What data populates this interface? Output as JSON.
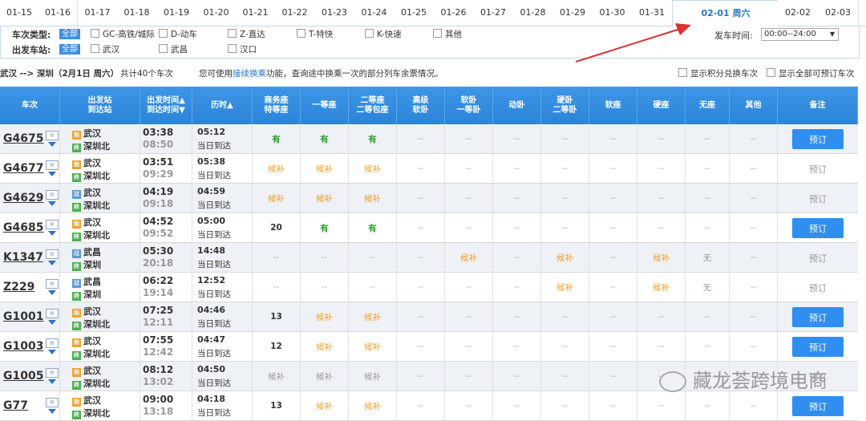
{
  "dates": [
    "01-15",
    "01-16",
    "01-17",
    "01-18",
    "01-19",
    "01-20",
    "01-21",
    "01-22",
    "01-23",
    "01-24",
    "01-25",
    "01-26",
    "01-27",
    "01-28",
    "01-29",
    "01-30",
    "01-31",
    "02-01 周六",
    "02-02",
    "02-03"
  ],
  "filters": {
    "type_label": "车次类型:",
    "type_all": "全部",
    "types": [
      "GC-高铁/城际",
      "D-动车",
      "Z-直达",
      "T-特快",
      "K-快速",
      "其他"
    ],
    "station_label": "出发车站:",
    "station_all": "全部",
    "stations": [
      "武汉",
      "武昌",
      "汉口"
    ],
    "depart_time_label": "发车时间:",
    "depart_time_value": "00:00--24:00"
  },
  "summary": {
    "route": "武汉 --> 深圳（2月1日 周六）",
    "count": "共计40个车次",
    "tip_pre": "您可使用",
    "tip_link": "接续换乘",
    "tip_post": "功能，查询途中换乘一次的部分列车余票情况。",
    "opt1": "显示积分兑换车次",
    "opt2": "显示全部可预订车次"
  },
  "headers": [
    "车次",
    "出发站\n到达站",
    "出发时间▲\n到达时间▼",
    "历时▲",
    "商务座\n特等座",
    "一等座",
    "二等座\n二等包座",
    "高级\n软卧",
    "软卧\n一等卧",
    "动卧",
    "硬卧\n二等卧",
    "软座",
    "硬座",
    "无座",
    "其他",
    "备注"
  ],
  "rows": [
    {
      "train": "G4675",
      "from": "武汉",
      "to": "深圳北",
      "from_type": "始",
      "dep": "03:38",
      "arr": "08:50",
      "dur": "05:12",
      "day": "当日到达",
      "seats": [
        "有",
        "有",
        "有",
        "--",
        "--",
        "--",
        "--",
        "--",
        "--",
        "--",
        "--"
      ],
      "action": "预订",
      "bookable": true
    },
    {
      "train": "G4677",
      "from": "武汉",
      "to": "深圳北",
      "from_type": "始",
      "dep": "03:51",
      "arr": "09:29",
      "dur": "05:38",
      "day": "当日到达",
      "seats": [
        "候补",
        "候补",
        "候补",
        "--",
        "--",
        "--",
        "--",
        "--",
        "--",
        "--",
        "--"
      ],
      "action": "预订",
      "bookable": false
    },
    {
      "train": "G4629",
      "from": "武汉",
      "to": "深圳北",
      "from_type": "过",
      "dep": "04:19",
      "arr": "09:18",
      "dur": "04:59",
      "day": "当日到达",
      "seats": [
        "候补",
        "候补",
        "候补",
        "--",
        "--",
        "--",
        "--",
        "--",
        "--",
        "--",
        "--"
      ],
      "action": "预订",
      "bookable": false
    },
    {
      "train": "G4685",
      "from": "武汉",
      "to": "深圳北",
      "from_type": "始",
      "dep": "04:52",
      "arr": "09:52",
      "dur": "05:00",
      "day": "当日到达",
      "seats": [
        "20",
        "有",
        "有",
        "--",
        "--",
        "--",
        "--",
        "--",
        "--",
        "--",
        "--"
      ],
      "action": "预订",
      "bookable": true
    },
    {
      "train": "K1347",
      "from": "武昌",
      "to": "深圳",
      "from_type": "过",
      "dep": "05:30",
      "arr": "20:18",
      "dur": "14:48",
      "day": "当日到达",
      "seats": [
        "--",
        "--",
        "--",
        "--",
        "候补",
        "--",
        "候补",
        "--",
        "候补",
        "无",
        "--"
      ],
      "action": "预订",
      "bookable": false
    },
    {
      "train": "Z229",
      "from": "武昌",
      "to": "深圳",
      "from_type": "过",
      "dep": "06:22",
      "arr": "19:14",
      "dur": "12:52",
      "day": "当日到达",
      "seats": [
        "--",
        "--",
        "--",
        "--",
        "--",
        "--",
        "候补",
        "--",
        "候补",
        "无",
        "--"
      ],
      "action": "预订",
      "bookable": false
    },
    {
      "train": "G1001",
      "from": "武汉",
      "to": "深圳北",
      "from_type": "始",
      "dep": "07:25",
      "arr": "12:11",
      "dur": "04:46",
      "day": "当日到达",
      "seats": [
        "13",
        "候补",
        "候补",
        "--",
        "--",
        "--",
        "--",
        "--",
        "--",
        "--",
        "--"
      ],
      "action": "预订",
      "bookable": true
    },
    {
      "train": "G1003",
      "from": "武汉",
      "to": "深圳北",
      "from_type": "始",
      "dep": "07:55",
      "arr": "12:42",
      "dur": "04:47",
      "day": "当日到达",
      "seats": [
        "12",
        "候补",
        "候补",
        "--",
        "--",
        "--",
        "--",
        "--",
        "--",
        "--",
        "--"
      ],
      "action": "预订",
      "bookable": true
    },
    {
      "train": "G1005",
      "from": "武汉",
      "to": "深圳北",
      "from_type": "始",
      "dep": "08:12",
      "arr": "13:02",
      "dur": "04:50",
      "day": "当日到达",
      "seats": [
        "候补",
        "候补",
        "候补",
        "--",
        "--",
        "--",
        "--",
        "--",
        "--",
        "--",
        "--"
      ],
      "action": "预订",
      "bookable": false
    },
    {
      "train": "G77",
      "from": "武汉",
      "to": "深圳北",
      "from_type": "始",
      "dep": "09:00",
      "arr": "13:18",
      "dur": "04:18",
      "day": "当日到达",
      "seats": [
        "13",
        "候补",
        "候补",
        "--",
        "--",
        "--",
        "--",
        "--",
        "--",
        "--",
        "--"
      ],
      "action": "预订",
      "bookable": true
    }
  ],
  "watermark": "藏龙荟跨境电商",
  "colors": {
    "header": "#3d96e6",
    "accent": "#2f8ef0",
    "available": "#2e9a2e",
    "waitlist": "#f29c1f",
    "annotation": "#e03030"
  }
}
